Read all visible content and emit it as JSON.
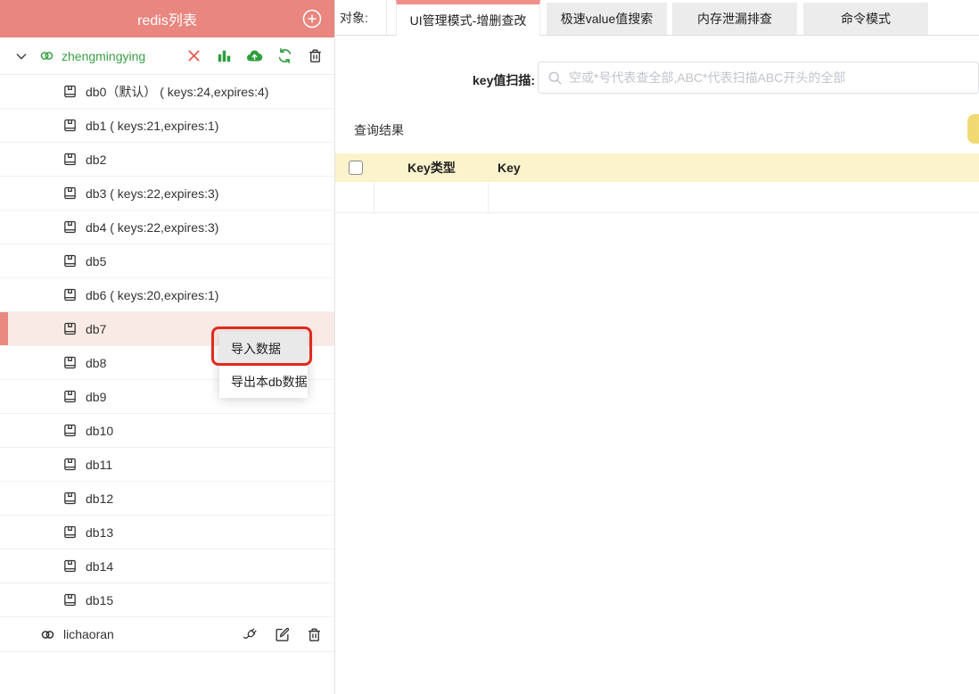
{
  "sidebar": {
    "title": "redis列表",
    "connection": {
      "name": "zhengmingying"
    },
    "databases": [
      {
        "text": "db0（默认） ( keys:24,expires:4)"
      },
      {
        "text": "db1 ( keys:21,expires:1)"
      },
      {
        "text": "db2"
      },
      {
        "text": "db3 ( keys:22,expires:3)"
      },
      {
        "text": "db4 ( keys:22,expires:3)"
      },
      {
        "text": "db5"
      },
      {
        "text": "db6 ( keys:20,expires:1)"
      },
      {
        "text": "db7"
      },
      {
        "text": "db8"
      },
      {
        "text": "db9"
      },
      {
        "text": "db10"
      },
      {
        "text": "db11"
      },
      {
        "text": "db12"
      },
      {
        "text": "db13"
      },
      {
        "text": "db14"
      },
      {
        "text": "db15"
      }
    ],
    "bottom_connection": {
      "name": "lichaoran"
    }
  },
  "context_menu": {
    "items": [
      {
        "label": "导入数据"
      },
      {
        "label": "导出本db数据"
      }
    ]
  },
  "main": {
    "object_label": "对象:",
    "tabs": [
      {
        "label": "UI管理模式-增删查改"
      },
      {
        "label": "极速value值搜索"
      },
      {
        "label": "内存泄漏排查"
      },
      {
        "label": "命令模式"
      }
    ],
    "scan_label": "key值扫描:",
    "scan_placeholder": "空或*号代表查全部,ABC*代表扫描ABC开头的全部",
    "results_title": "查询结果",
    "table": {
      "columns": [
        "Key类型",
        "Key"
      ]
    }
  },
  "colors": {
    "header": "#e8867f",
    "selected_row": "#faeae6",
    "selected_accent": "#e9897f",
    "green": "#39a044",
    "table_header": "#faf3cc",
    "yellow_button": "#f1da74",
    "annotation_red": "#df2b1d",
    "active_tab_bar": "#f0908a"
  }
}
